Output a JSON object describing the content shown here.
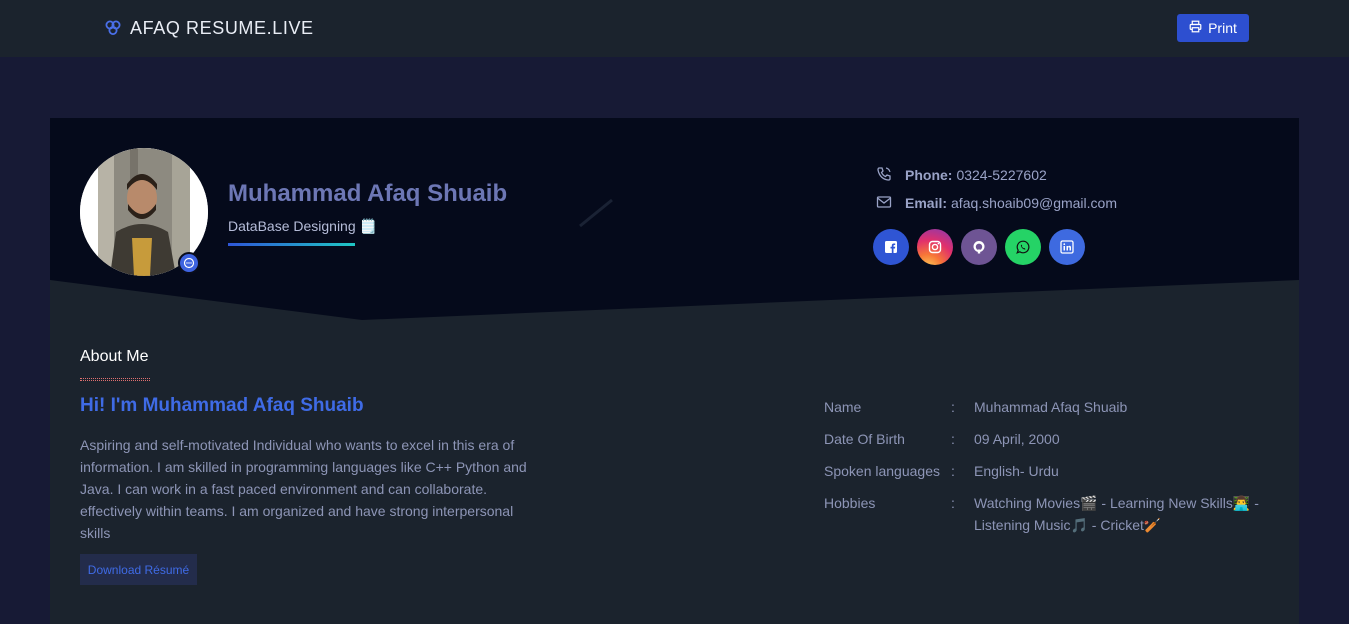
{
  "navbar": {
    "brand": "AFAQ RESUME.LIVE",
    "brand_icon": "triple-circle-logo-icon",
    "print_label": "Print",
    "print_icon": "printer-icon"
  },
  "hero": {
    "name": "Muhammad Afaq Shuaib",
    "role": "DataBase Designing 🗒️",
    "avatar_badge_icon": "chat-badge-icon",
    "contact": {
      "phone_label": "Phone:",
      "phone_value": "0324-5227602",
      "email_label": "Email:",
      "email_value": "afaq.shoaib09@gmail.com"
    },
    "socials": [
      {
        "name": "facebook-icon",
        "color": "#2f55d4"
      },
      {
        "name": "instagram-icon",
        "color": "#e1306c"
      },
      {
        "name": "github-icon",
        "color": "#6e5494"
      },
      {
        "name": "whatsapp-icon",
        "color": "#25d366"
      },
      {
        "name": "linkedin-icon",
        "color": "#3e6ae0"
      }
    ]
  },
  "about": {
    "title": "About Me",
    "greeting": "Hi! I'm Muhammad Afaq Shuaib",
    "bio": "Aspiring and self-motivated Individual who wants to excel in this era of information. I am skilled in programming languages like C++ Python and Java. I can work in a fast paced environment and can collaborate. effectively within teams. I am organized and have strong interpersonal skills",
    "download_label": "Download Résumé",
    "info": [
      {
        "label": "Name",
        "colon": ":",
        "value": "Muhammad Afaq Shuaib"
      },
      {
        "label": "Date Of Birth",
        "colon": ":",
        "value": "09 April, 2000"
      },
      {
        "label": "Spoken languages",
        "colon": ":",
        "value": "English- Urdu"
      },
      {
        "label": "Hobbies",
        "colon": ":",
        "value": "Watching Movies🎬 - Learning New Skills👨‍💻 - Listening Music🎵 - Cricket🏏"
      }
    ]
  },
  "colors": {
    "page_bg": "#171a35",
    "nav_bg": "#1b232d",
    "hero_bg": "#050a1b",
    "accent": "#3f6be6",
    "print_button": "#2d4fd0"
  }
}
